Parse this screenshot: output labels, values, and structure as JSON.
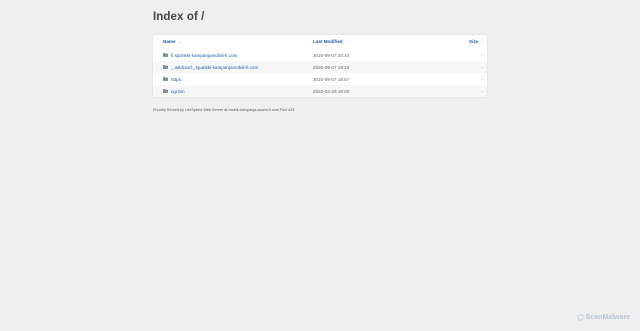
{
  "page": {
    "title": "Index of /"
  },
  "table": {
    "headers": {
      "name": "Name",
      "modified": "Last Modified",
      "size": "Size",
      "name_sort": "↕",
      "modified_sort": "↓",
      "size_sort": "↕"
    },
    "rows": [
      {
        "name": "fi.spankki-kampanjamobili-fi.com",
        "modified": "2025-09-07 20:44",
        "size": "-"
      },
      {
        "name": "_.wildcard._spankki-kampanjamobili-fi.com",
        "modified": "2025-09-07 19:34",
        "size": "-"
      },
      {
        "name": "https:",
        "modified": "2025-09-07 18:57",
        "size": "-"
      },
      {
        "name": "cgi-bin",
        "modified": "2025-03-29 16:00",
        "size": "-"
      }
    ]
  },
  "footer": {
    "text": "Proudly Served by LiteSpeed Web Server at mobili-kampanja-suomi-fi.com Port 443"
  },
  "watermark": {
    "text": "ScanMalware"
  },
  "icons": {
    "folder": "folder-icon",
    "sort": "sort-icon"
  },
  "colors": {
    "background": "#efefef",
    "link": "#1a5fb4",
    "card": "#ffffff",
    "watermark": "#b8c4cf"
  }
}
